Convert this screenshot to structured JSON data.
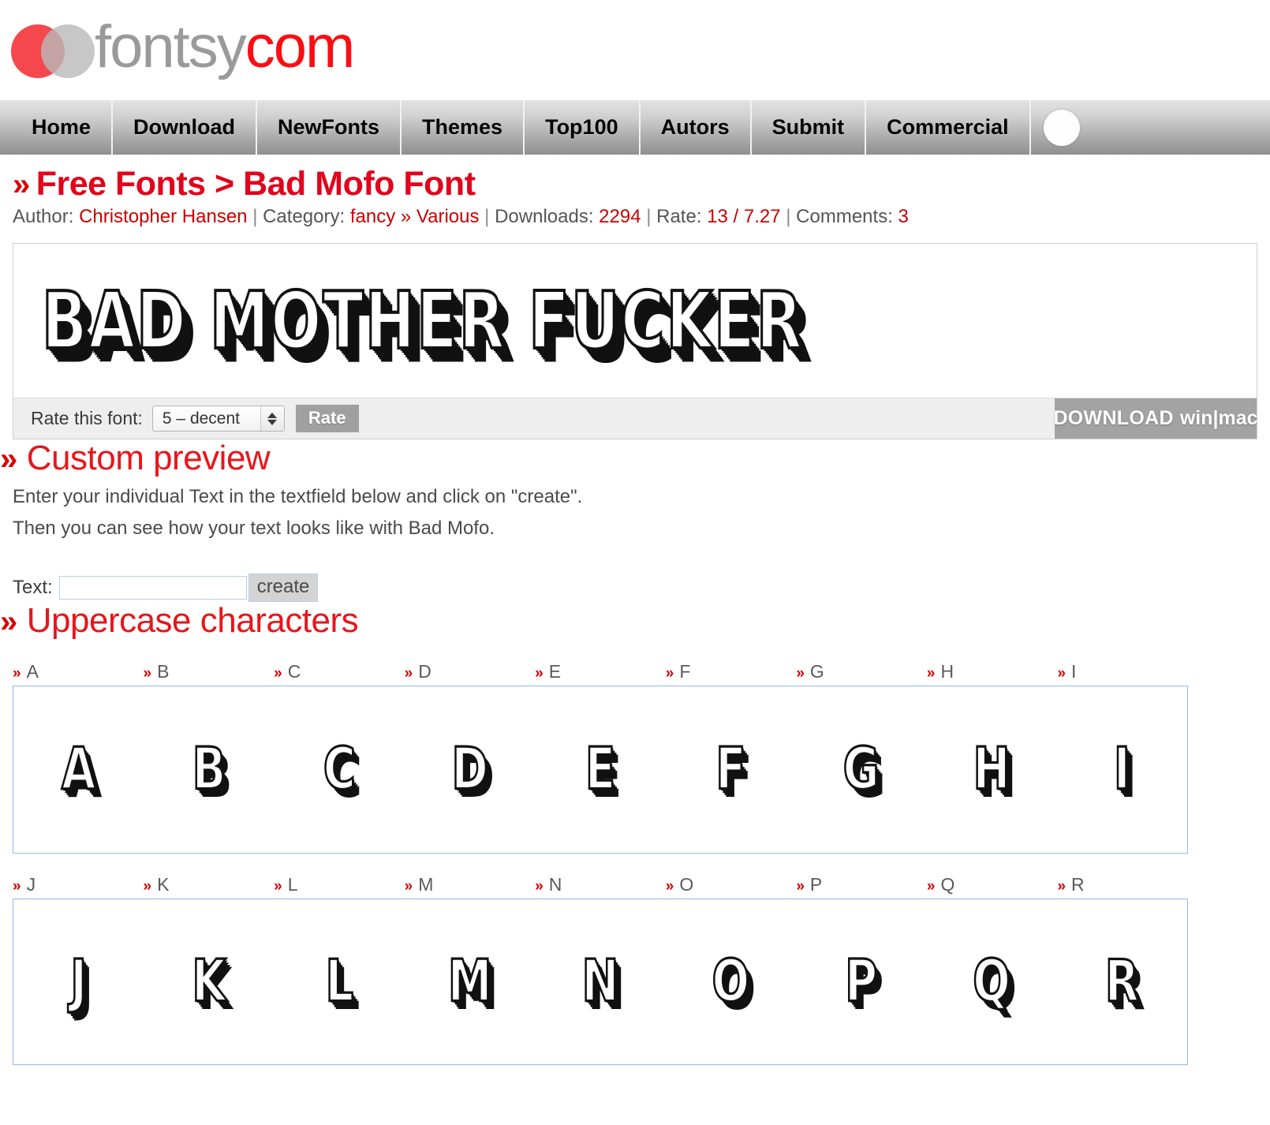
{
  "site": {
    "logo_text_gray": "fontsy",
    "logo_text_red": "com"
  },
  "nav": {
    "items": [
      {
        "label": "Home"
      },
      {
        "label": "Download"
      },
      {
        "label": "NewFonts"
      },
      {
        "label": "Themes"
      },
      {
        "label": "Top100"
      },
      {
        "label": "Autors"
      },
      {
        "label": "Submit"
      },
      {
        "label": "Commercial"
      }
    ]
  },
  "page": {
    "chevron": "»",
    "title_prefix": "Free Fonts",
    "title_separator": ">",
    "title_name": "Bad Mofo Font",
    "meta": {
      "author_label": "Author:",
      "author_value": "Christopher Hansen",
      "category_label": "Category:",
      "category_value": "fancy",
      "category_chevron": "»",
      "category_sub": "Various",
      "downloads_label": "Downloads:",
      "downloads_value": "2294",
      "rate_label": "Rate:",
      "rate_value": "13 / 7.27",
      "comments_label": "Comments:",
      "comments_value": "3",
      "divider": "|"
    }
  },
  "preview": {
    "sample_text": "BAD MOTHER FUCKER",
    "rate_this_label": "Rate this font:",
    "rate_select_value": "5 – decent",
    "rate_button": "Rate",
    "download_main": "DOWNLOAD",
    "download_sub": "win|mac"
  },
  "custom_preview": {
    "heading": "Custom preview",
    "line1": "Enter your individual Text in the textfield below and click on \"create\".",
    "line2": "Then you can see how your text looks like with Bad Mofo.",
    "text_label": "Text:",
    "text_value": "",
    "text_placeholder": "",
    "create_button": "create"
  },
  "uppercase": {
    "heading": "Uppercase characters",
    "row1": [
      "A",
      "B",
      "C",
      "D",
      "E",
      "F",
      "G",
      "H",
      "I"
    ],
    "row2": [
      "J",
      "K",
      "L",
      "M",
      "N",
      "O",
      "P",
      "Q",
      "R"
    ]
  },
  "colors": {
    "red": "#e2021b",
    "heading_red": "#e8151b",
    "link_red": "#cc0000",
    "gray_text": "#555555",
    "grid_border": "#8fbbe8"
  }
}
